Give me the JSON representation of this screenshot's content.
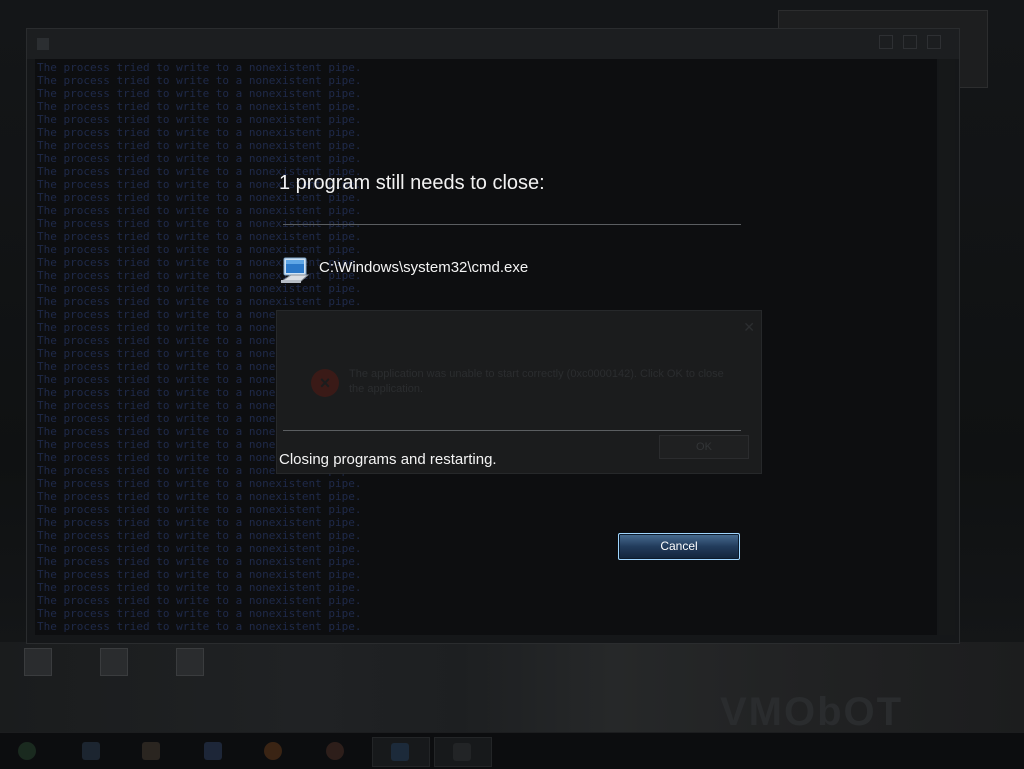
{
  "dialog": {
    "heading": "1 program still needs to close:",
    "programs": [
      {
        "path": "C:\\Windows\\system32\\cmd.exe",
        "icon": "console-window-icon"
      }
    ],
    "status": "Closing programs and restarting.",
    "cancel_label": "Cancel"
  },
  "background_error": {
    "message": "The application was unable to start correctly (0xc0000142). Click OK to close the application.",
    "ok_label": "OK"
  },
  "cmd_window": {
    "line_text": "The process tried to write to a nonexistent pipe."
  },
  "desktop": {
    "brand_text": "VMObOT"
  },
  "colors": {
    "overlay_bg": "#0b0c0d",
    "heading_text": "#f2f2f2",
    "divider": "#5b5e61",
    "cancel_border": "#9fd6ff",
    "cancel_fill_top": "#4a6f93",
    "cancel_fill_bottom": "#12243a"
  }
}
